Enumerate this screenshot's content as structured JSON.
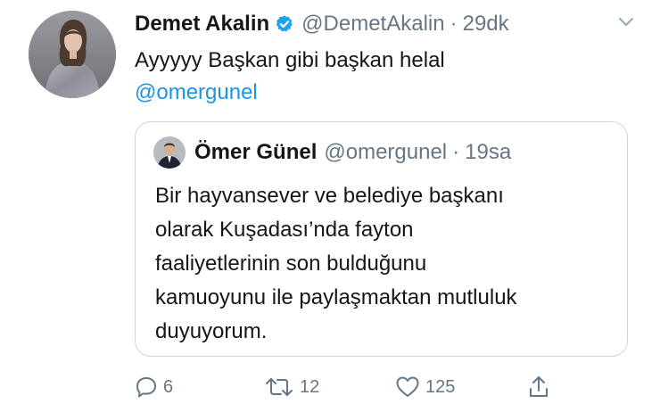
{
  "tweet": {
    "author": {
      "display_name": "Demet Akalin",
      "handle": "@DemetAkalin",
      "verified": true,
      "avatar_icon": "profile-photo"
    },
    "separator": "·",
    "time": "29dk",
    "text": "Ayyyyy Başkan gibi başkan helal",
    "mention": "@omergunel",
    "menu_icon": "chevron-down-icon"
  },
  "quoted_tweet": {
    "author": {
      "display_name": "Ömer Günel",
      "handle": "@omergunel",
      "avatar_icon": "profile-photo"
    },
    "separator": "·",
    "time": "19sa",
    "lines": [
      "Bir hayvansever ve belediye başkanı",
      "olarak Kuşadası’nda fayton",
      "faaliyetlerinin son bulduğunu",
      "kamuoyunu ile paylaşmaktan mutluluk",
      "duyuyorum."
    ]
  },
  "actions": {
    "reply": {
      "icon": "reply-icon",
      "count": "6"
    },
    "retweet": {
      "icon": "retweet-icon",
      "count": "12"
    },
    "like": {
      "icon": "heart-icon",
      "count": "125"
    },
    "share": {
      "icon": "share-icon"
    }
  },
  "colors": {
    "text": "#14171a",
    "secondary": "#657786",
    "link": "#1b95e0",
    "verified": "#1da1f2",
    "border": "#ccd6dd"
  }
}
